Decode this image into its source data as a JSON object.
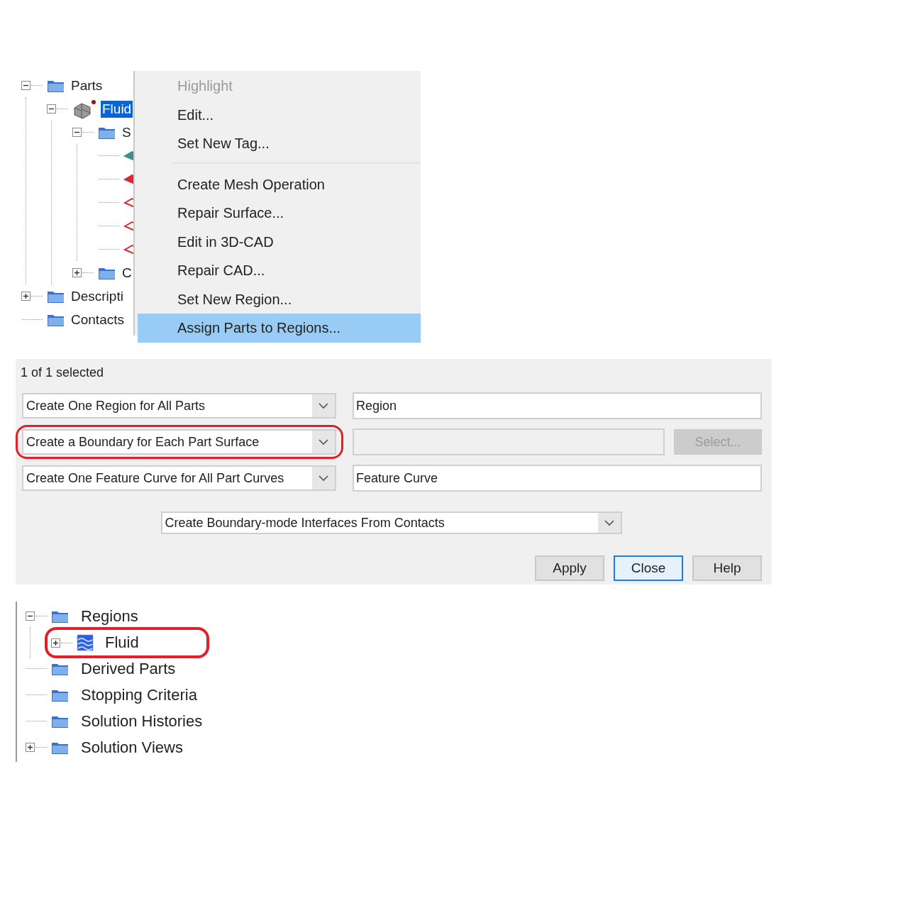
{
  "parts_tree": {
    "items": [
      {
        "label": "Parts",
        "kind": "folder",
        "expanded": true,
        "selected": false,
        "children": [
          {
            "label": "Fluid",
            "kind": "part",
            "expanded": true,
            "selected": true,
            "children": [
              {
                "label": "S",
                "kind": "folder",
                "expanded": true,
                "selected": false,
                "children": [
                  {
                    "kind": "surface",
                    "color": "#3f8f86",
                    "filled": true
                  },
                  {
                    "kind": "surface",
                    "color": "#e0262b",
                    "filled": true
                  },
                  {
                    "kind": "surface",
                    "color": "#e0262b",
                    "filled": false
                  },
                  {
                    "kind": "surface",
                    "color": "#e0262b",
                    "filled": false
                  },
                  {
                    "kind": "surface",
                    "color": "#e0262b",
                    "filled": false
                  }
                ]
              },
              {
                "label": "C",
                "kind": "folder",
                "expanded": false,
                "selected": false
              }
            ]
          }
        ]
      },
      {
        "label": "Descripti",
        "kind": "folder",
        "expanded": false,
        "selected": false
      },
      {
        "label": "Contacts",
        "kind": "folder",
        "selected": false
      }
    ]
  },
  "context_menu": {
    "groups": [
      [
        {
          "label": "Highlight",
          "disabled": true,
          "selected": false
        },
        {
          "label": "Edit...",
          "disabled": false,
          "selected": false
        },
        {
          "label": "Set New Tag...",
          "disabled": false,
          "selected": false
        }
      ],
      [
        {
          "label": "Create Mesh Operation",
          "disabled": false,
          "selected": false
        },
        {
          "label": "Repair Surface...",
          "disabled": false,
          "selected": false
        },
        {
          "label": "Edit in 3D-CAD",
          "disabled": false,
          "selected": false
        },
        {
          "label": "Repair CAD...",
          "disabled": false,
          "selected": false
        },
        {
          "label": "Set New Region...",
          "disabled": false,
          "selected": false
        },
        {
          "label": "Assign Parts to Regions...",
          "disabled": false,
          "selected": true
        }
      ]
    ]
  },
  "dialog": {
    "status": "1 of 1 selected",
    "rows": [
      {
        "dropdown": {
          "value": "Create One Region for All Parts"
        },
        "field": {
          "value": "Region",
          "disabled": false
        }
      },
      {
        "dropdown": {
          "value": "Create a Boundary for Each Part Surface",
          "highlighted": true
        },
        "field": {
          "disabled": true
        },
        "button": {
          "label": "Select...",
          "disabled": true
        }
      },
      {
        "dropdown": {
          "value": "Create One Feature Curve for All Part Curves"
        },
        "field": {
          "value": "Feature Curve",
          "disabled": false
        }
      }
    ],
    "interfaces_dropdown": {
      "value": "Create Boundary-mode Interfaces From Contacts"
    },
    "buttons": [
      {
        "label": "Apply",
        "focused": false
      },
      {
        "label": "Close",
        "focused": true
      },
      {
        "label": "Help",
        "focused": false
      }
    ]
  },
  "regions_tree": {
    "items": [
      {
        "label": "Regions",
        "kind": "folder",
        "expanded": true,
        "selected": false,
        "children": [
          {
            "label": "Fluid",
            "kind": "region",
            "expanded": false,
            "highlighted": true,
            "selected": false
          }
        ]
      },
      {
        "label": "Derived Parts",
        "kind": "folder",
        "selected": false
      },
      {
        "label": "Stopping Criteria",
        "kind": "folder",
        "selected": false
      },
      {
        "label": "Solution Histories",
        "kind": "folder",
        "selected": false
      },
      {
        "label": "Solution Views",
        "kind": "folder",
        "expanded": false,
        "selected": false
      }
    ]
  }
}
